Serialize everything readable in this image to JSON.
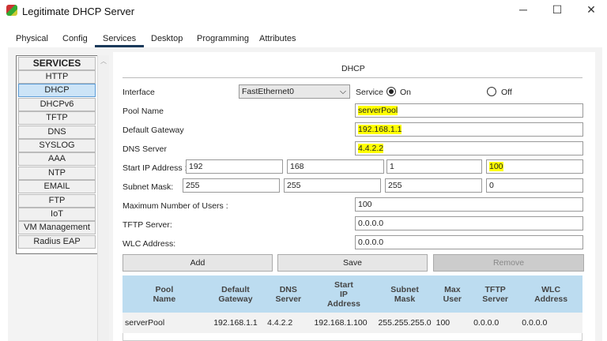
{
  "window": {
    "title": "Legitimate DHCP Server",
    "minimize": "─",
    "maximize": "☐",
    "close": "✕"
  },
  "tabs": [
    "Physical",
    "Config",
    "Services",
    "Desktop",
    "Programming",
    "Attributes"
  ],
  "sidebar": {
    "header": "SERVICES",
    "items": [
      "HTTP",
      "DHCP",
      "DHCPv6",
      "TFTP",
      "DNS",
      "SYSLOG",
      "AAA",
      "NTP",
      "EMAIL",
      "FTP",
      "IoT",
      "VM Management",
      "Radius EAP"
    ],
    "selected": "DHCP"
  },
  "dhcp": {
    "heading": "DHCP",
    "interface_label": "Interface",
    "interface_value": "FastEthernet0",
    "service_label": "Service",
    "on_label": "On",
    "off_label": "Off",
    "service_state": "On",
    "pool_name_label": "Pool Name",
    "pool_name": "serverPool",
    "gateway_label": "Default Gateway",
    "gateway": "192.168.1.1",
    "dns_label": "DNS Server",
    "dns": "4.4.2.2",
    "start_ip_label": "Start IP Address :",
    "start_ip": [
      "192",
      "168",
      "1",
      "100"
    ],
    "subnet_label": "Subnet Mask:",
    "subnet": [
      "255",
      "255",
      "255",
      "0"
    ],
    "max_users_label": "Maximum Number of Users :",
    "max_users": "100",
    "tftp_label": "TFTP Server:",
    "tftp": "0.0.0.0",
    "wlc_label": "WLC Address:",
    "wlc": "0.0.0.0",
    "add_label": "Add",
    "save_label": "Save",
    "remove_label": "Remove"
  },
  "table": {
    "headers": [
      "Pool\nName",
      "Default\nGateway",
      "DNS\nServer",
      "Start\nIP\nAddress",
      "Subnet\nMask",
      "Max\nUser",
      "TFTP\nServer",
      "WLC\nAddress"
    ],
    "rows": [
      [
        "serverPool",
        "192.168.1.1",
        "4.4.2.2",
        "192.168.1.100",
        "255.255.255.0",
        "100",
        "0.0.0.0",
        "0.0.0.0"
      ]
    ]
  },
  "colors": {
    "highlight": "#ffff00",
    "table_header": "#bcdcf0",
    "selected": "#cce4f7"
  }
}
